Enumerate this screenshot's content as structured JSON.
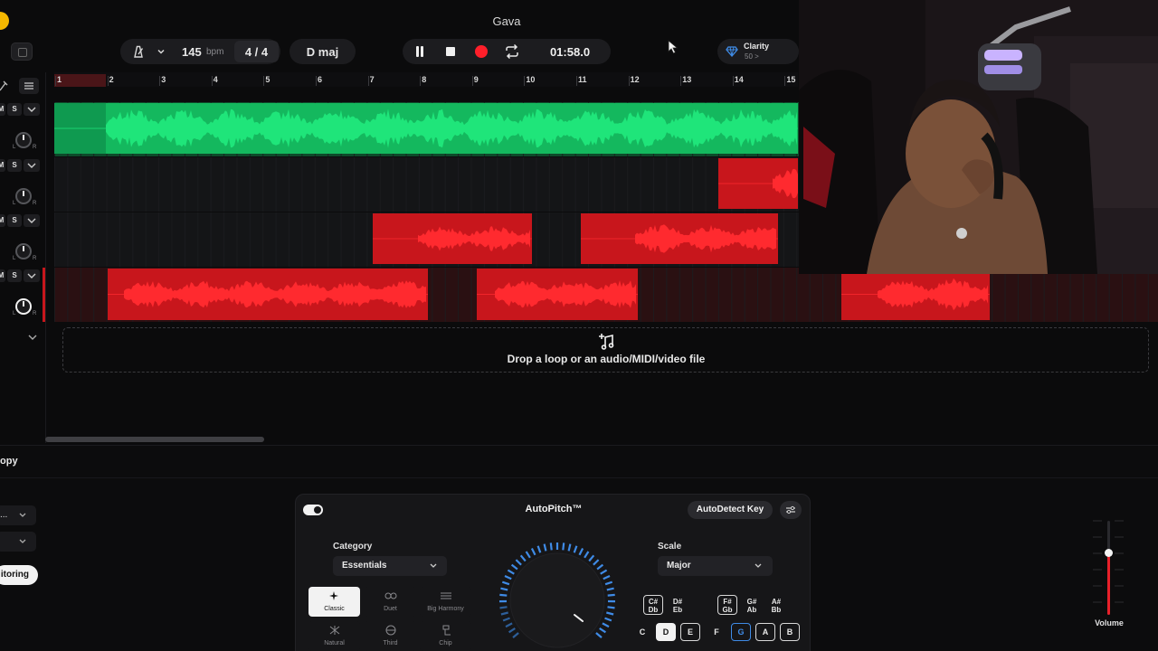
{
  "window": {
    "title": "Gava"
  },
  "transport": {
    "tempo": "145",
    "tempo_unit": "bpm",
    "time_signature": "4 / 4",
    "key": "D maj",
    "time": "01:58.0",
    "is_playing": true
  },
  "clarity": {
    "label": "Clarity",
    "value": "50 >"
  },
  "tracks": [
    {
      "mute": "M",
      "solo": "S",
      "pan_l": "L",
      "pan_r": "R"
    },
    {
      "mute": "M",
      "solo": "S",
      "pan_l": "L",
      "pan_r": "R"
    },
    {
      "mute": "M",
      "solo": "S",
      "pan_l": "L",
      "pan_r": "R"
    },
    {
      "mute": "M",
      "solo": "S",
      "pan_l": "L",
      "pan_r": "R"
    }
  ],
  "ruler": {
    "bars": [
      "1",
      "2",
      "3",
      "4",
      "5",
      "6",
      "7",
      "8",
      "9",
      "10",
      "11",
      "12",
      "13",
      "14",
      "15"
    ]
  },
  "drop_zone": {
    "text": "Drop a loop or an audio/MIDI/video file"
  },
  "bottom_panel": {
    "title": "opy",
    "dropdown1": "...",
    "monitoring_label": "itoring"
  },
  "autopitch": {
    "title": "AutoPitch™",
    "enabled": true,
    "autodetect_label": "AutoDetect Key",
    "category_label": "Category",
    "category_value": "Essentials",
    "scale_label": "Scale",
    "scale_value": "Major",
    "categories": [
      {
        "label": "Classic",
        "active": true
      },
      {
        "label": "Duet",
        "active": false
      },
      {
        "label": "Big Harmony",
        "active": false
      },
      {
        "label": "Natural",
        "active": false
      },
      {
        "label": "Third",
        "active": false
      },
      {
        "label": "Chip",
        "active": false
      }
    ],
    "sharps": [
      {
        "top": "C#",
        "bottom": "Db",
        "on": true
      },
      {
        "top": "D#",
        "bottom": "Eb",
        "on": false
      },
      {
        "top": "F#",
        "bottom": "Gb",
        "on": true
      },
      {
        "top": "G#",
        "bottom": "Ab",
        "on": false
      },
      {
        "top": "A#",
        "bottom": "Bb",
        "on": false
      }
    ],
    "naturals": [
      {
        "label": "C",
        "on": false
      },
      {
        "label": "D",
        "on": true
      },
      {
        "label": "E",
        "on": true
      },
      {
        "label": "F",
        "on": false
      },
      {
        "label": "G",
        "on": true
      },
      {
        "label": "A",
        "on": true
      },
      {
        "label": "B",
        "on": true
      }
    ]
  },
  "volume": {
    "label": "Volume",
    "level": 0.66
  },
  "colors": {
    "accent_green": "#14b85e",
    "accent_red": "#c8161c",
    "record": "#ff1f2a",
    "autopitch_blue": "#3f8be6"
  }
}
